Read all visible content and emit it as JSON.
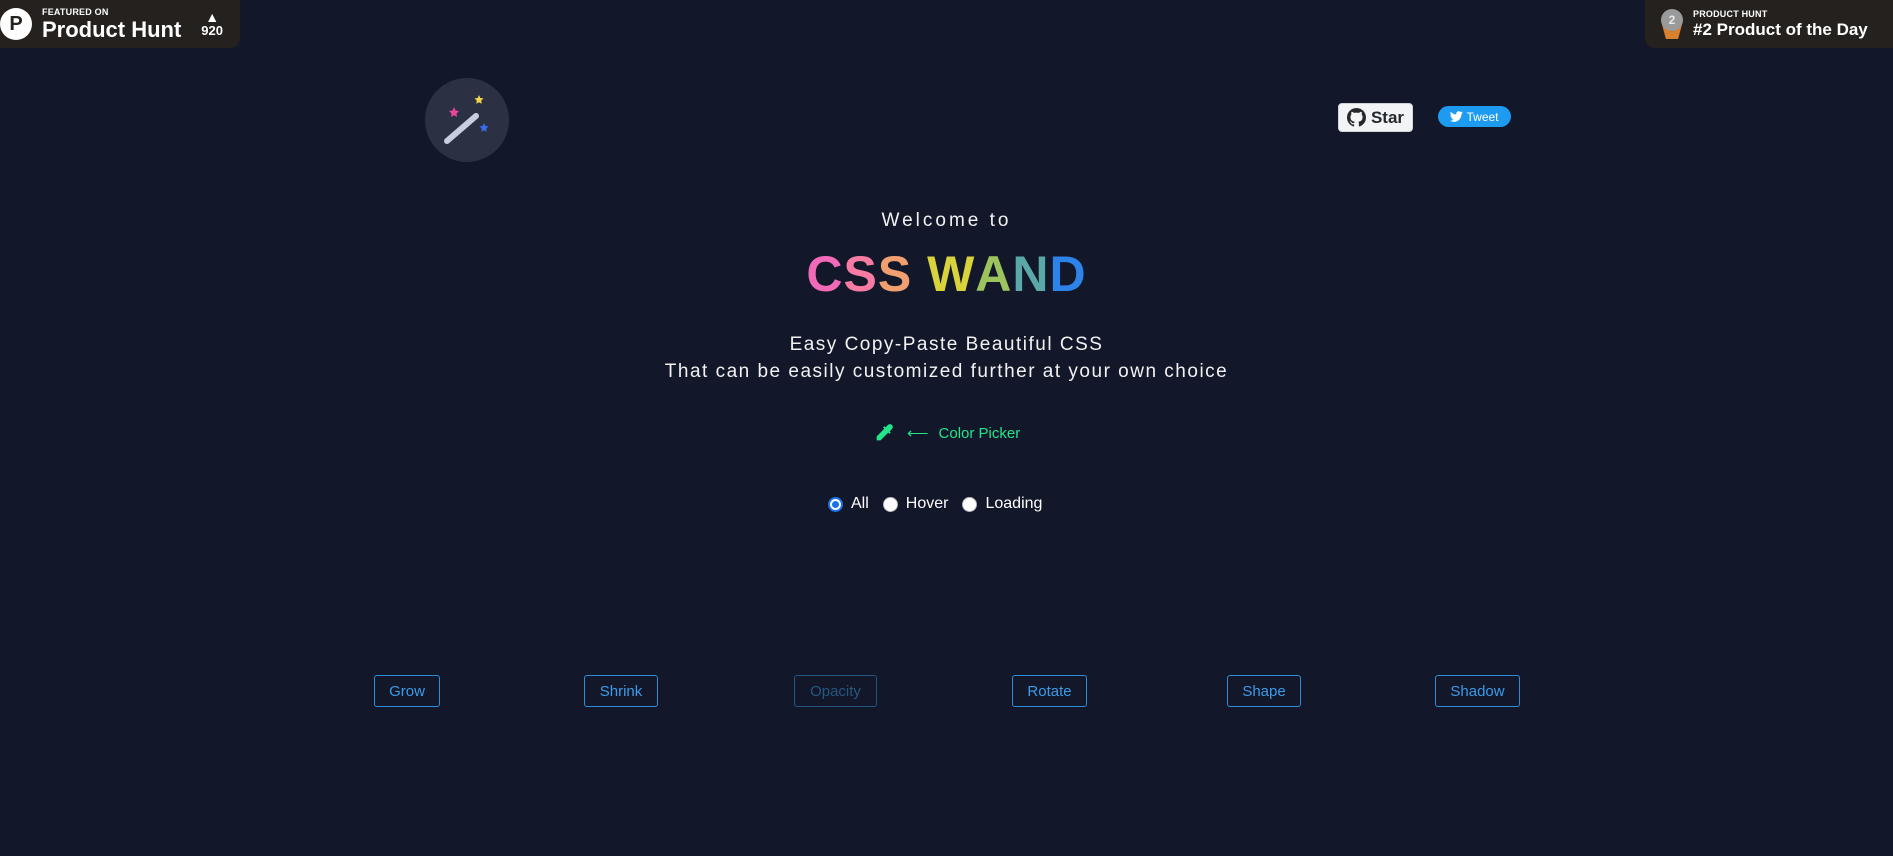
{
  "ph_featured": {
    "small_label": "FEATURED ON",
    "name": "Product Hunt",
    "logo_letter": "P",
    "vote_arrow": "▲",
    "votes": "920"
  },
  "ph_rank": {
    "medal_number": "2",
    "small_label": "PRODUCT HUNT",
    "title": "#2 Product of the Day"
  },
  "github": {
    "label": "Star"
  },
  "twitter": {
    "label": "Tweet"
  },
  "hero": {
    "welcome": "Welcome to",
    "title_letters": [
      {
        "char": "C",
        "color": "#f06ab8"
      },
      {
        "char": "S",
        "color": "#f77ba2"
      },
      {
        "char": "S",
        "color": "#f0a070"
      },
      {
        "char": " ",
        "color": "#ffffff"
      },
      {
        "char": "W",
        "color": "#d8d23c"
      },
      {
        "char": "A",
        "color": "#9bc45e"
      },
      {
        "char": "N",
        "color": "#5aa8a8"
      },
      {
        "char": "D",
        "color": "#2e83e8"
      }
    ],
    "tagline_1": "Easy Copy-Paste Beautiful CSS",
    "tagline_2": "That can be easily customized further at your own choice"
  },
  "color_picker": {
    "arrow": "⟵",
    "label": "Color Picker",
    "accent": "#22e58a"
  },
  "filters": {
    "selected": "All",
    "options": [
      "All",
      "Hover",
      "Loading"
    ]
  },
  "effects": [
    {
      "label": "Grow",
      "dimmed": false
    },
    {
      "label": "Shrink",
      "dimmed": false
    },
    {
      "label": "Opacity",
      "dimmed": true
    },
    {
      "label": "Rotate",
      "dimmed": false
    },
    {
      "label": "Shape",
      "dimmed": false
    },
    {
      "label": "Shadow",
      "dimmed": false
    }
  ],
  "colors": {
    "background": "#12172a",
    "button_border": "#2f8cd8",
    "button_text": "#3d9be9"
  }
}
